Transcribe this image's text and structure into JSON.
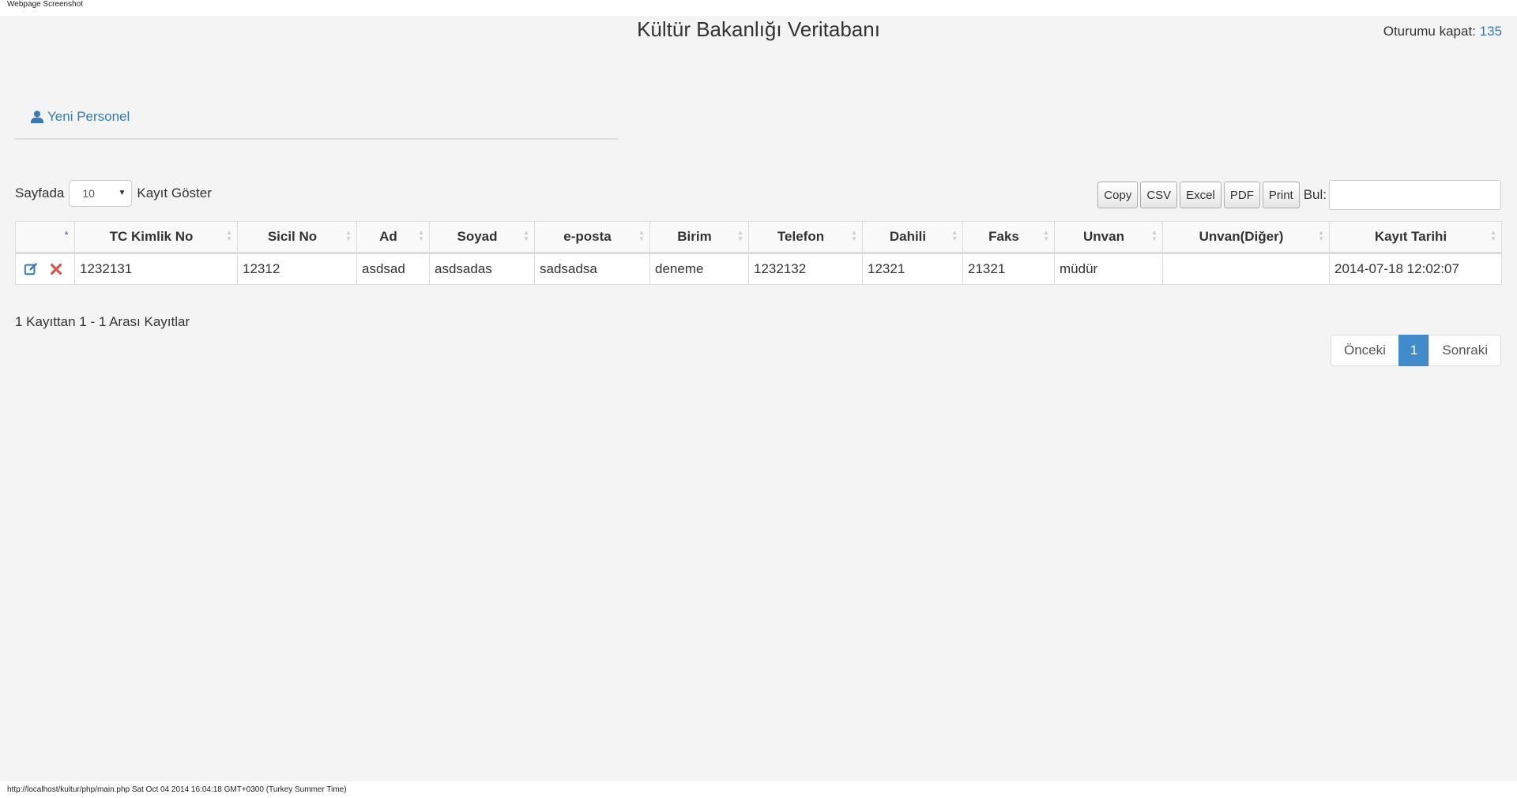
{
  "browser": {
    "caption": "Webpage Screenshot",
    "status_url": "http://localhost/kultur/php/main.php Sat Oct 04 2014 16:04:18 GMT+0300 (Turkey Summer Time)"
  },
  "header": {
    "title": "Kültür Bakanlığı Veritabanı",
    "logout_label": "Oturumu kapat:",
    "user_id": "135"
  },
  "toolbar": {
    "new_person_label": "Yeni Personel",
    "new_person_icon": "user-icon"
  },
  "length_control": {
    "prefix": "Sayfada",
    "selected": "10",
    "suffix": "Kayıt Göster"
  },
  "export_buttons": [
    "Copy",
    "CSV",
    "Excel",
    "PDF",
    "Print"
  ],
  "search": {
    "label": "Bul:",
    "value": ""
  },
  "table": {
    "columns": [
      "TC Kimlik No",
      "Sicil No",
      "Ad",
      "Soyad",
      "e-posta",
      "Birim",
      "Telefon",
      "Dahili",
      "Faks",
      "Unvan",
      "Unvan(Diğer)",
      "Kayıt Tarihi"
    ],
    "rows": [
      [
        "1232131",
        "12312",
        "asdsad",
        "asdsadas",
        "sadsadsa",
        "deneme",
        "1232132",
        "12321",
        "21321",
        "müdür",
        "",
        "2014-07-18 12:02:07"
      ]
    ],
    "row_icons": [
      "edit-icon",
      "delete-icon"
    ],
    "colors": {
      "edit": "#337ab7",
      "delete": "#d9534f"
    }
  },
  "info": "1 Kayıttan 1 - 1 Arası Kayıtlar",
  "pagination": {
    "prev": "Önceki",
    "current": "1",
    "next": "Sonraki"
  },
  "colors": {
    "accent": "#337ab7",
    "active_page": "#428bca",
    "background": "#f4f4f4"
  }
}
